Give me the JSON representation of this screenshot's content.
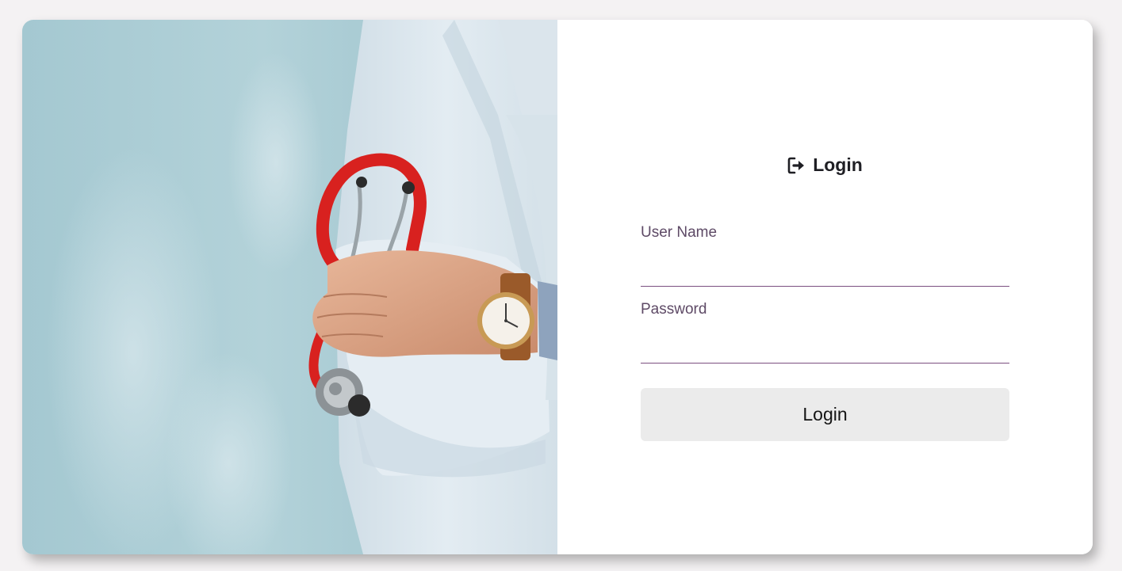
{
  "login_form": {
    "title": "Login",
    "title_icon": "sign-in-icon",
    "username": {
      "label": "User Name",
      "value": "",
      "placeholder": ""
    },
    "password": {
      "label": "Password",
      "value": "",
      "placeholder": ""
    },
    "submit_label": "Login"
  },
  "hero_image": {
    "subject": "doctor-with-stethoscope",
    "icons": [
      "stethoscope-icon",
      "wristwatch-icon"
    ]
  },
  "colors": {
    "page_background": "#f4f2f3",
    "card_background": "#ffffff",
    "input_underline": "#7b4f80",
    "label_text": "#5e4a66",
    "button_background": "#ebebeb",
    "stethoscope_red": "#d8211f",
    "photo_background": "#a9cbd3"
  }
}
